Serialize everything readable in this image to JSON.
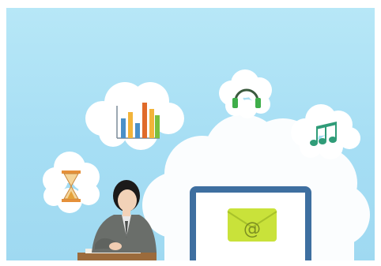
{
  "scene": {
    "background_color": "#a6def4",
    "cloud_color": "#ffffff",
    "accent_bar_colors": [
      "#4a90c8",
      "#f2b43a",
      "#e06a2a",
      "#7bbf3e"
    ],
    "headphones_color": "#3fae4a",
    "music_note_color": "#2f9c78",
    "hourglass_color": "#e5903a",
    "screen_frame_color": "#3e6fa0",
    "envelope_color": "#c9e23a",
    "email_symbol": "@"
  },
  "icons": {
    "bar_chart": "bar-chart-icon",
    "headphones": "headphones-icon",
    "music": "music-notes-icon",
    "hourglass": "hourglass-icon",
    "email": "email-envelope-icon"
  }
}
